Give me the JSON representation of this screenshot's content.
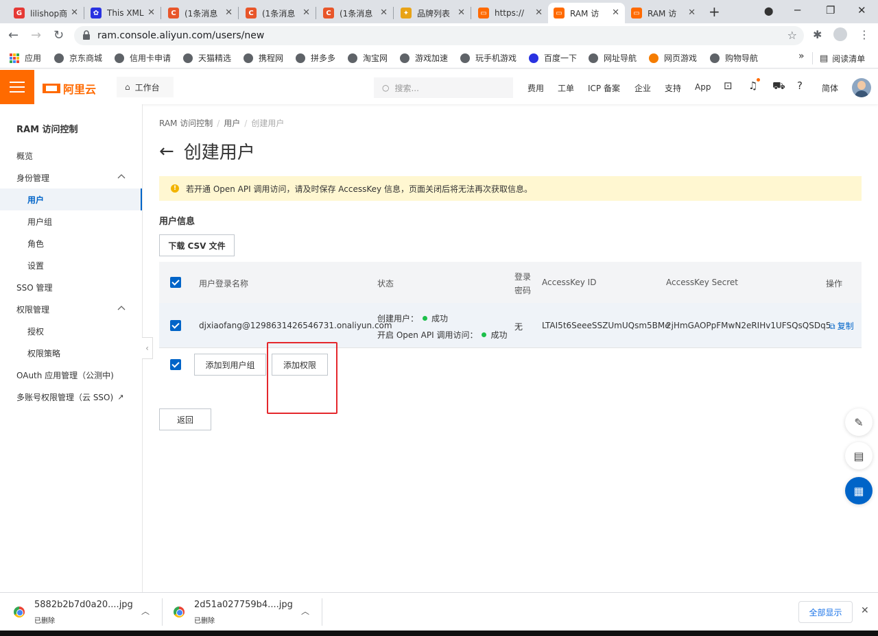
{
  "browser": {
    "tabs": [
      {
        "title": "lilishop商",
        "color": "#e53935",
        "glyph": "G"
      },
      {
        "title": "This XML",
        "color": "#2932e1",
        "glyph": "✿"
      },
      {
        "title": "(1条消息",
        "color": "#e8562a",
        "glyph": "C"
      },
      {
        "title": "(1条消息",
        "color": "#e8562a",
        "glyph": "C"
      },
      {
        "title": "(1条消息",
        "color": "#e8562a",
        "glyph": "C"
      },
      {
        "title": "品牌列表",
        "color": "#e8a317",
        "glyph": "✦"
      },
      {
        "title": "https://",
        "color": "#ff6a00",
        "glyph": "▭"
      },
      {
        "title": "RAM 访",
        "color": "#ff6a00",
        "glyph": "▭"
      },
      {
        "title": "RAM 访",
        "color": "#ff6a00",
        "glyph": "▭"
      }
    ],
    "url": "ram.console.aliyun.com/users/new",
    "bookmarks": [
      "应用",
      "京东商城",
      "信用卡申请",
      "天猫精选",
      "携程网",
      "拼多多",
      "淘宝网",
      "游戏加速",
      "玩手机游戏",
      "百度一下",
      "网址导航",
      "网页游戏",
      "购物导航"
    ],
    "reading_list": "阅读清单"
  },
  "console": {
    "logo": "阿里云",
    "workbench": "工作台",
    "search_placeholder": "搜索...",
    "nav": [
      "费用",
      "工单",
      "ICP 备案",
      "企业",
      "支持",
      "App"
    ],
    "lang": "简体"
  },
  "sidebar": {
    "title": "RAM 访问控制",
    "items": [
      {
        "label": "概览"
      },
      {
        "label": "身份管理"
      },
      {
        "label": "用户"
      },
      {
        "label": "用户组"
      },
      {
        "label": "角色"
      },
      {
        "label": "设置"
      },
      {
        "label": "SSO 管理"
      },
      {
        "label": "权限管理"
      },
      {
        "label": "授权"
      },
      {
        "label": "权限策略"
      },
      {
        "label": "OAuth 应用管理（公测中)"
      },
      {
        "label": "多账号权限管理（云 SSO)"
      }
    ]
  },
  "main": {
    "breadcrumb": [
      "RAM 访问控制",
      "用户",
      "创建用户"
    ],
    "title": "创建用户",
    "notice": "若开通 Open API 调用访问，请及时保存 AccessKey 信息，页面关闭后将无法再次获取信息。",
    "section": "用户信息",
    "download_csv": "下载 CSV 文件",
    "table": {
      "headers": {
        "login_name": "用户登录名称",
        "status": "状态",
        "login_pwd_1": "登录",
        "login_pwd_2": "密码",
        "ak_id": "AccessKey ID",
        "ak_secret": "AccessKey Secret",
        "action": "操作"
      },
      "row": {
        "login_name": "djxiaofang@1298631426546731.onaliyun.com",
        "status_create_label": "创建用户：",
        "status_create_value": "成功",
        "status_api_label": "开启 Open API 调用访问：",
        "status_api_value": "成功",
        "password": "无",
        "ak_id": "LTAI5t6SeeeSSZUmUQsm5BMe",
        "ak_secret": "2jHmGAOPpFMwN2eRIHv1UFSQsQSDq5",
        "action": "复制"
      }
    },
    "add_to_group": "添加到用户组",
    "add_permission": "添加权限",
    "back": "返回"
  },
  "downloads": [
    {
      "name": "5882b2b7d0a20....jpg",
      "status": "已删除"
    },
    {
      "name": "2d51a027759b4....jpg",
      "status": "已删除"
    }
  ],
  "show_all": "全部显示"
}
